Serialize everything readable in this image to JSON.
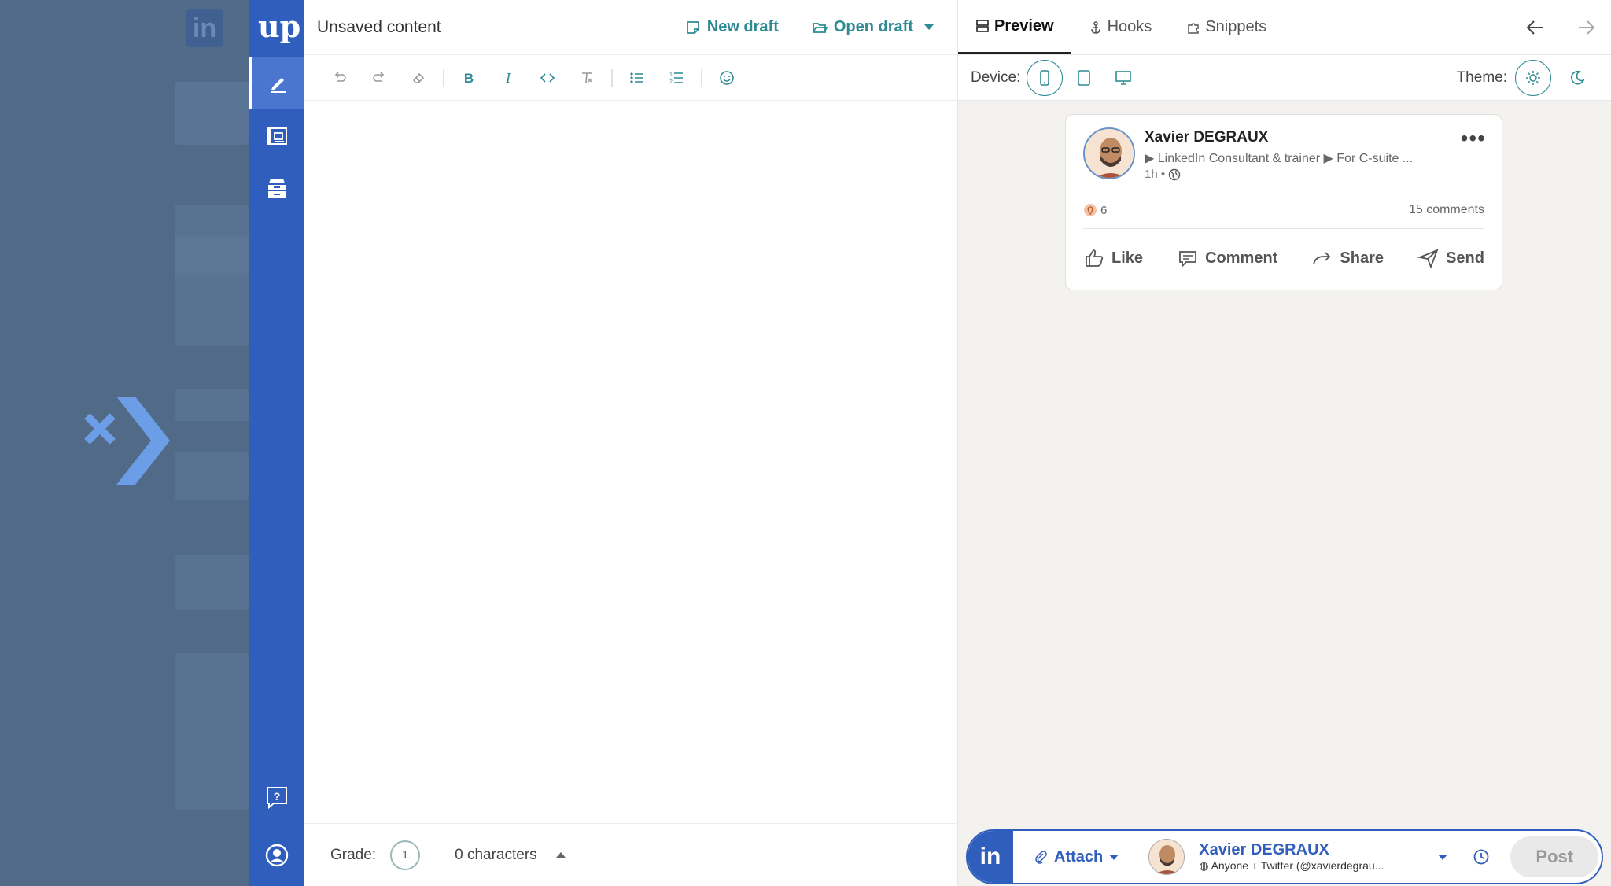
{
  "background": {
    "linkedin_logo": "in"
  },
  "rail": {
    "logo": "up",
    "items": [
      {
        "icon": "pen-icon",
        "active": true
      },
      {
        "icon": "dashboard-icon",
        "active": false
      },
      {
        "icon": "archive-icon",
        "active": false
      }
    ],
    "bottom": [
      {
        "icon": "help-icon"
      },
      {
        "icon": "user-account-icon"
      }
    ]
  },
  "editor": {
    "title": "Unsaved content",
    "new_draft_label": "New draft",
    "open_draft_label": "Open draft",
    "footer": {
      "grade_label": "Grade:",
      "grade_value": "1",
      "characters": "0 characters"
    }
  },
  "toolbar": {
    "buttons": [
      "undo-icon",
      "redo-icon",
      "eraser-icon",
      "bold-icon",
      "italic-icon",
      "code-icon",
      "clear-format-icon",
      "bullet-list-icon",
      "numbered-list-icon",
      "emoji-icon"
    ]
  },
  "preview": {
    "tabs": [
      {
        "label": "Preview",
        "active": true
      },
      {
        "label": "Hooks",
        "active": false
      },
      {
        "label": "Snippets",
        "active": false
      }
    ],
    "device_label": "Device:",
    "theme_label": "Theme:",
    "post": {
      "author": "Xavier DEGRAUX",
      "headline": "▶ LinkedIn Consultant & trainer ▶ For C-suite ...",
      "time": "1h •",
      "reactions": "6",
      "comments": "15 comments",
      "actions": [
        "Like",
        "Comment",
        "Share",
        "Send"
      ]
    }
  },
  "publish": {
    "network": "in",
    "attach_label": "Attach",
    "account_name": "Xavier DEGRAUX",
    "audience": "Anyone + Twitter (@xavierdegrau...",
    "post_label": "Post"
  },
  "colors": {
    "accent": "#2e8a93",
    "brand_blue": "#2f5ebd"
  }
}
